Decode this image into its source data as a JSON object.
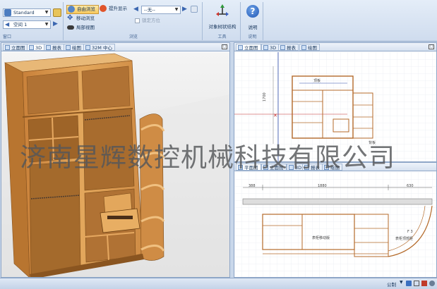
{
  "ribbon": {
    "view_group": {
      "style_value": "Standard",
      "space_value": "空间 1",
      "caption": "窗口"
    },
    "browse_group": {
      "orbit_label": "自由浏览",
      "pan_label": "移动浏览",
      "zoom_out_label": "局部视图",
      "lift_label": "提升显示",
      "caption": "浏览"
    },
    "select_group": {
      "filter_value": "--无--",
      "lock_label": "锁定方位"
    },
    "tools_group": {
      "transform_label": "对象树状结构",
      "caption": "工具"
    },
    "help_group": {
      "help_label": "说明",
      "caption": "说明"
    }
  },
  "left_pane": {
    "tabs": [
      "立面图",
      "3D",
      "报表",
      "绘图",
      "32M 中心"
    ],
    "active_tab": 1
  },
  "top_right_pane": {
    "tabs": [
      "立面图",
      "3D",
      "报表",
      "绘图"
    ],
    "label_top": "顶板",
    "dims_note": "背板",
    "dims_value": "1700"
  },
  "bottom_right_pane": {
    "tabs": [
      "平面图",
      "立面图",
      "3D",
      "报表",
      "绘图"
    ],
    "dim_left": "388",
    "dim_middle": "1880",
    "dim_right": "630",
    "label_left": "表柜移动版",
    "label_right": "表柜顶部柜",
    "label_right_number": "F 3"
  },
  "watermark": "济南星辉数控机械科技有限公司",
  "status": {
    "units": "公制"
  },
  "colors": {
    "wood": "#d99a4a",
    "wood_dark": "#b8772f",
    "ribbon_bg": "#dbe6f4",
    "cad_line": "#b46a2a",
    "cad_blue": "#2c4aa8"
  }
}
